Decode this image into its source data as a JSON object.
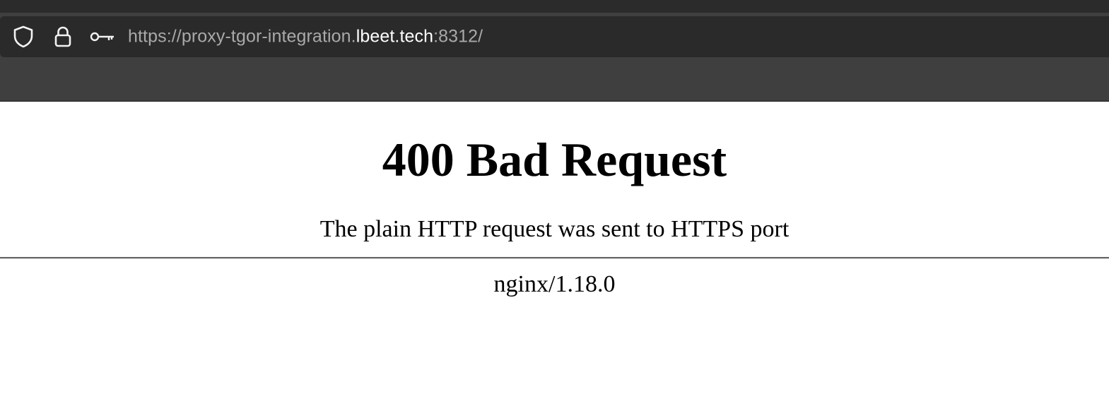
{
  "browser": {
    "url_prefix": "https://proxy-tgor-integration.",
    "url_host": "lbeet.tech",
    "url_suffix": ":8312/",
    "icons": [
      "shield-icon",
      "lock-icon",
      "key-icon"
    ]
  },
  "page": {
    "title": "400 Bad Request",
    "message": "The plain HTTP request was sent to HTTPS port",
    "server": "nginx/1.18.0"
  },
  "colors": {
    "toolbar": "#3f3f3f",
    "urlbar": "#2a2a2a",
    "url_dim": "#a9a9a9",
    "url_host": "#ffffff"
  }
}
